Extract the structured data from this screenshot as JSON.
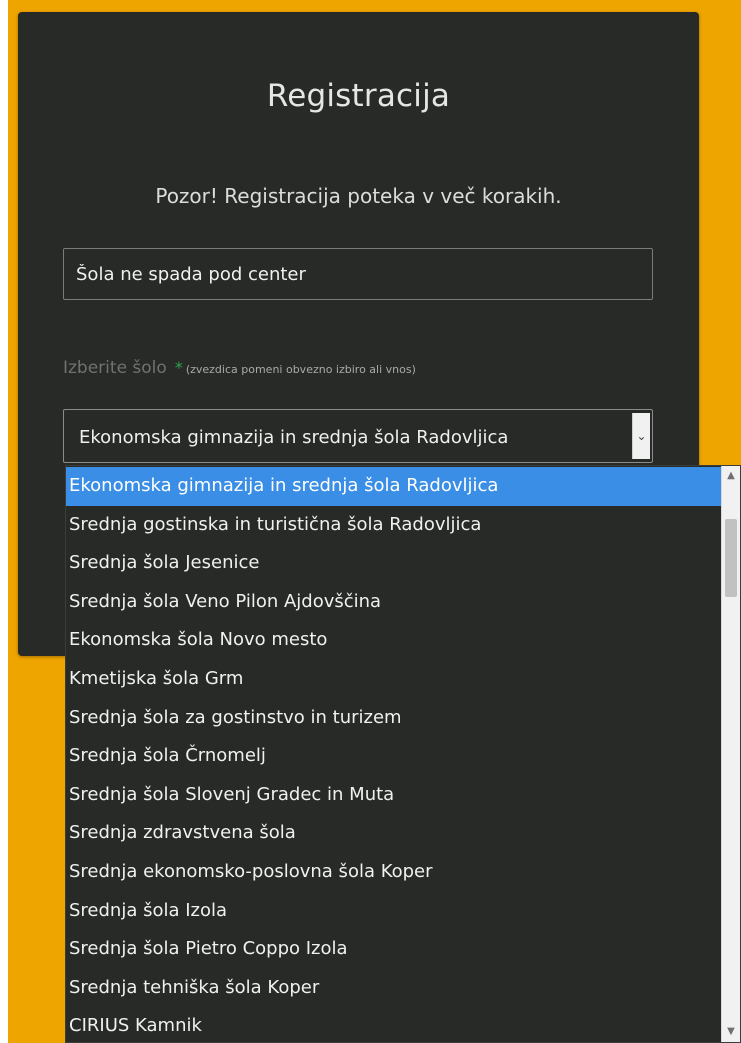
{
  "form": {
    "title": "Registracija",
    "notice": "Pozor! Registracija poteka v več korakih.",
    "center_field_value": "Šola ne spada pod center",
    "school_label": "Izberite šolo",
    "required_star": "*",
    "required_note": "(zvezdica pomeni obvezno izbiro ali vnos)",
    "school_select_value": "Ekonomska gimnazija in srednja šola Radovljica"
  },
  "dropdown": {
    "selected_index": 0,
    "options": [
      "Ekonomska gimnazija in srednja šola Radovljica",
      "Srednja gostinska in turistična šola Radovljica",
      "Srednja šola Jesenice",
      "Srednja šola Veno Pilon Ajdovščina",
      "Ekonomska šola Novo mesto",
      "Kmetijska šola Grm",
      "Srednja šola za gostinstvo in turizem",
      "Srednja šola Črnomelj",
      "Srednja šola Slovenj Gradec in Muta",
      "Srednja zdravstvena šola",
      "Srednja ekonomsko-poslovna šola Koper",
      "Srednja šola Izola",
      "Srednja šola Pietro Coppo Izola",
      "Srednja tehniška šola Koper",
      "CIRIUS Kamnik"
    ]
  },
  "icons": {
    "select_arrow": "chevron-down-icon",
    "scroll_up": "chevron-up-icon",
    "scroll_down": "chevron-down-icon"
  },
  "colors": {
    "page_background": "#efa500",
    "card_background": "#272a27",
    "selected_option": "#3a8ee6",
    "required_star": "#2fa24a"
  }
}
